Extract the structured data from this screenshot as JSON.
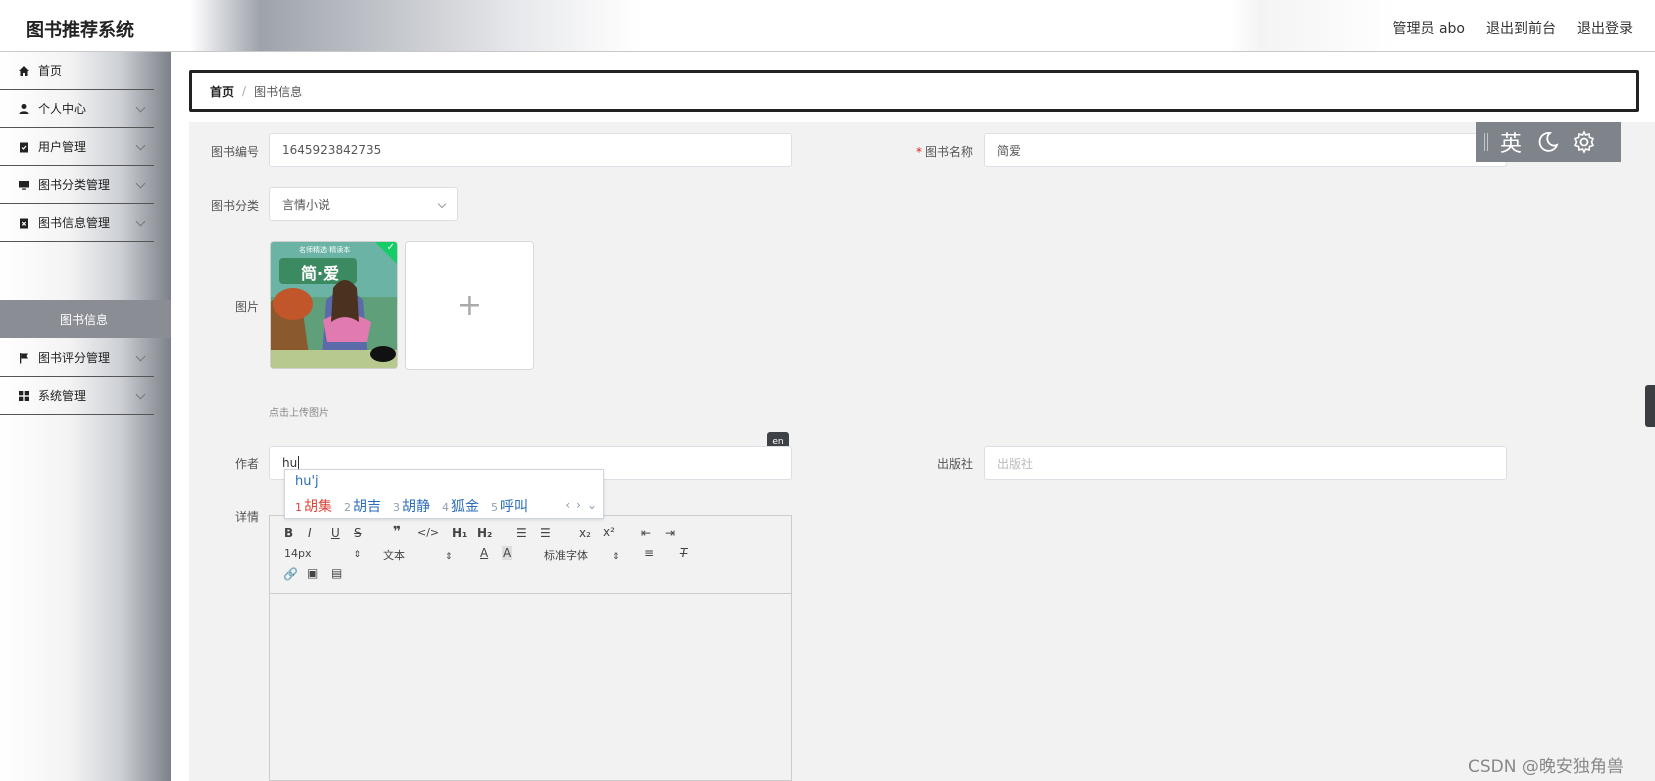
{
  "header": {
    "title": "图书推荐系统",
    "user_label": "管理员 abo",
    "front_link": "退出到前台",
    "logout_link": "退出登录"
  },
  "sidebar": {
    "items": [
      {
        "label": "首页",
        "icon": "home-icon"
      },
      {
        "label": "个人中心",
        "icon": "user-icon"
      },
      {
        "label": "用户管理",
        "icon": "clipboard-check-icon"
      },
      {
        "label": "图书分类管理",
        "icon": "monitor-icon"
      },
      {
        "label": "图书信息管理",
        "icon": "clipboard-x-icon"
      },
      {
        "label": "图书评分管理",
        "icon": "flag-icon"
      },
      {
        "label": "系统管理",
        "icon": "grid-icon"
      }
    ],
    "active_sub": "图书信息"
  },
  "breadcrumb": {
    "home": "首页",
    "separator": "/",
    "current": "图书信息"
  },
  "form": {
    "book_no_label": "图书编号",
    "book_no_value": "1645923842735",
    "book_name_label": "图书名称",
    "book_name_required": "*",
    "book_name_value": "简爱",
    "category_label": "图书分类",
    "category_value": "言情小说",
    "image_label": "图片",
    "upload_plus": "+",
    "upload_tip": "点击上传图片",
    "author_label": "作者",
    "author_value": "hu",
    "publisher_label": "出版社",
    "publisher_placeholder": "出版社",
    "detail_label": "详情"
  },
  "cover": {
    "top_banner": "名师精选·精读本",
    "title": "简·爱"
  },
  "ime": {
    "composition": "hu'j",
    "candidates": [
      {
        "n": "1",
        "text": "胡集"
      },
      {
        "n": "2",
        "text": "胡吉"
      },
      {
        "n": "3",
        "text": "胡静"
      },
      {
        "n": "4",
        "text": "狐金"
      },
      {
        "n": "5",
        "text": "呼叫"
      }
    ]
  },
  "editor": {
    "font_size": "14px",
    "block": "文本",
    "font_family": "标准字体"
  },
  "imebar": {
    "lang": "英"
  },
  "en_badge": "en",
  "watermark": "CSDN @晚安独角兽",
  "colors": {
    "required": "#e02020",
    "success": "#13ce66",
    "ime_first": "#d9453a",
    "ime_text": "#2a6cb8"
  }
}
